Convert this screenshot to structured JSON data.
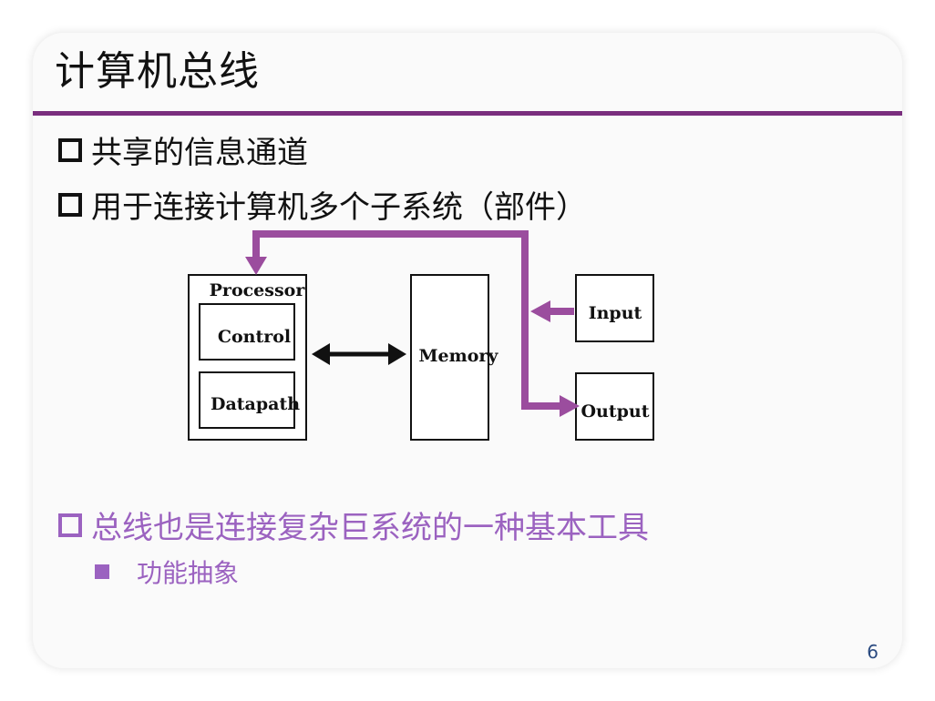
{
  "slide": {
    "title": "计算机总线",
    "bullets": [
      "共享的信息通道",
      "用于连接计算机多个子系统（部件）"
    ],
    "highlight_bullet": "总线也是连接复杂巨系统的一种基本工具",
    "sub_bullet": "功能抽象",
    "page_number": "6"
  },
  "diagram": {
    "processor_label": "Processor",
    "control_label": "Control",
    "datapath_label": "Datapath",
    "memory_label": "Memory",
    "input_label": "Input",
    "output_label": "Output",
    "bus_color": "#9b4d9e"
  }
}
